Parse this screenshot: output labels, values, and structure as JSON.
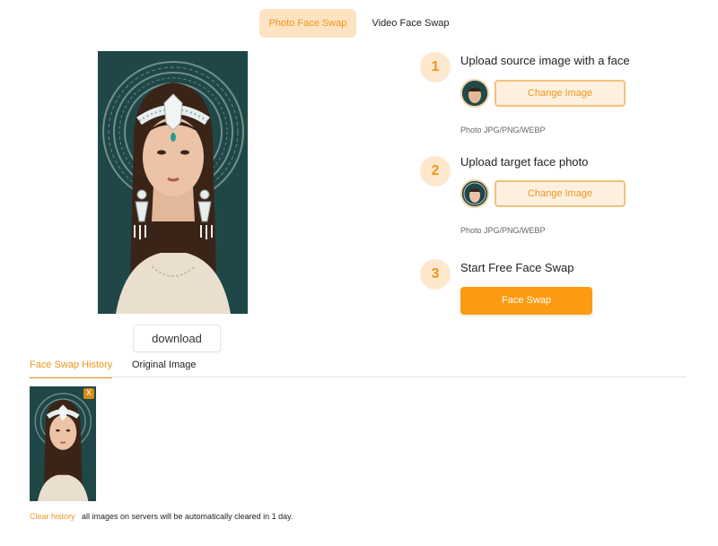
{
  "tabs": {
    "photo": "Photo Face Swap",
    "video": "Video Face Swap"
  },
  "result": {
    "download_label": "download"
  },
  "history_tabs": {
    "history": "Face Swap History",
    "original": "Original Image"
  },
  "history": {
    "close_label": "X",
    "clear_label": "Clear history",
    "note": "all images on servers will be automatically cleared in 1 day."
  },
  "steps": [
    {
      "number": "1",
      "title": "Upload source image with a face",
      "button": "Change Image",
      "hint": "Photo JPG/PNG/WEBP"
    },
    {
      "number": "2",
      "title": "Upload target face photo",
      "button": "Change Image",
      "hint": "Photo JPG/PNG/WEBP"
    },
    {
      "number": "3",
      "title": "Start Free Face Swap",
      "button": "Face Swap"
    }
  ],
  "colors": {
    "accent": "#f0961d",
    "accent_light": "#fde3c2",
    "swap_button": "#fb9b12",
    "portrait_bg": "#1f4748"
  }
}
